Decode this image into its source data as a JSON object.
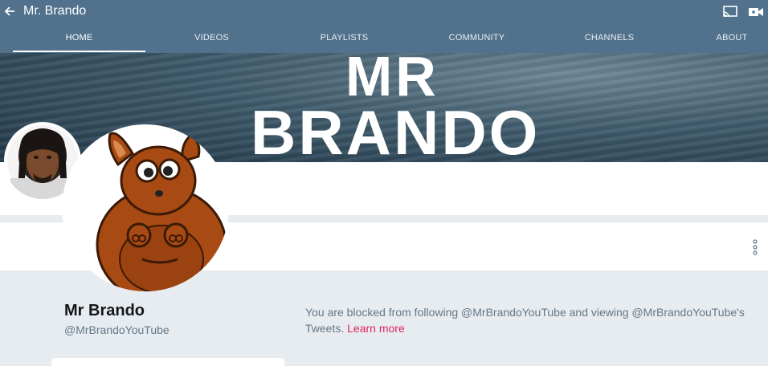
{
  "app_bar": {
    "title": "Mr. Brando",
    "tabs": [
      {
        "label": "HOME",
        "active": true
      },
      {
        "label": "VIDEOS",
        "active": false
      },
      {
        "label": "PLAYLISTS",
        "active": false
      },
      {
        "label": "COMMUNITY",
        "active": false
      },
      {
        "label": "CHANNELS",
        "active": false
      },
      {
        "label": "ABOUT",
        "active": false
      }
    ],
    "icons": [
      "back-arrow-icon",
      "cast-icon",
      "video-camera-icon"
    ],
    "color": "#51718c"
  },
  "banner": {
    "line1": "MR",
    "line2": "BRANDO"
  },
  "profile": {
    "name": "Mr Brando",
    "handle": "@MrBrandoYouTube",
    "blocked_message": "You are blocked from following @MrBrandoYouTube and viewing @MrBrandoYouTube's Tweets.",
    "learn_more": "Learn more",
    "link_color": "#e0245e"
  },
  "menu": {
    "icon": "more-vertical-icon"
  }
}
